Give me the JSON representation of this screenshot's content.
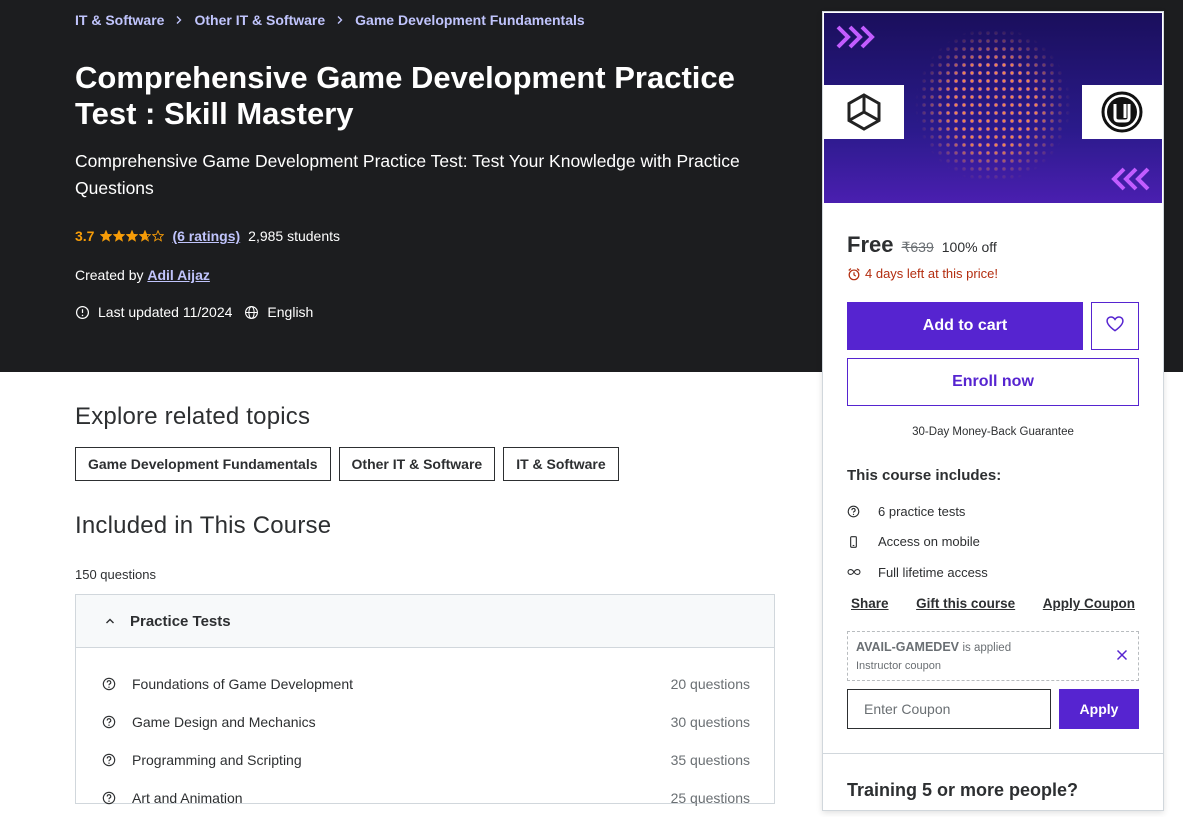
{
  "breadcrumb": [
    "IT & Software",
    "Other IT & Software",
    "Game Development Fundamentals"
  ],
  "course": {
    "title": "Comprehensive Game Development Practice Test : Skill Mastery",
    "subtitle": "Comprehensive Game Development Practice Test: Test Your Knowledge with Practice Questions",
    "rating": "3.7",
    "rating_value": 3.7,
    "ratings_link": "(6 ratings)",
    "students": "2,985 students",
    "created_label": "Created by",
    "instructor": "Adil Aijaz",
    "last_updated": "Last updated 11/2024",
    "language": "English"
  },
  "related": {
    "heading": "Explore related topics",
    "topics": [
      "Game Development Fundamentals",
      "Other IT & Software",
      "IT & Software"
    ]
  },
  "included": {
    "heading": "Included in This Course",
    "question_count": "150 questions",
    "section_title": "Practice Tests",
    "tests": [
      {
        "name": "Foundations of Game Development",
        "count": "20 questions"
      },
      {
        "name": "Game Design and Mechanics",
        "count": "30 questions"
      },
      {
        "name": "Programming and Scripting",
        "count": "35 questions"
      },
      {
        "name": "Art and Animation",
        "count": "25 questions"
      }
    ]
  },
  "purchase": {
    "price": "Free",
    "original_price": "₹639",
    "discount": "100% off",
    "timer": "4 days left at this price!",
    "add_to_cart": "Add to cart",
    "enroll": "Enroll now",
    "guarantee": "30-Day Money-Back Guarantee",
    "includes_title": "This course includes:",
    "includes": [
      "6 practice tests",
      "Access on mobile",
      "Full lifetime access"
    ],
    "share": "Share",
    "gift": "Gift this course",
    "apply_coupon": "Apply Coupon",
    "coupon_code": "AVAIL-GAMEDEV",
    "coupon_applied": "is applied",
    "coupon_type": "Instructor coupon",
    "coupon_placeholder": "Enter Coupon",
    "apply": "Apply",
    "training": "Training 5 or more people?"
  },
  "colors": {
    "hero_bg": "#1c1d1f",
    "brand_purple": "#5624d0",
    "link_lavender": "#c0c4fc",
    "star": "#f69c08",
    "timer_red": "#b32d0f"
  }
}
